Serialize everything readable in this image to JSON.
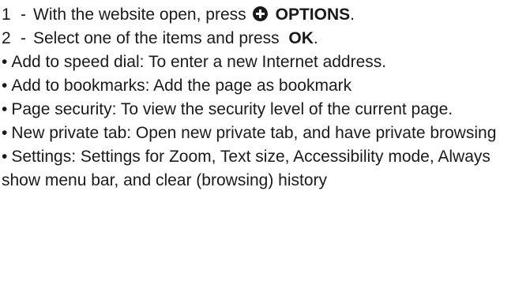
{
  "steps": [
    {
      "number": "1",
      "dash": "-",
      "text_before": "With the website open, press",
      "icon": "plus-circle-icon",
      "key_label": "OPTIONS",
      "text_after": "."
    },
    {
      "number": "2",
      "dash": "-",
      "text_before": "Select one of the items and press",
      "key_label": "OK",
      "text_after": "."
    }
  ],
  "bullet_char": "•",
  "items": [
    "Add to speed dial: To enter a new Internet address.",
    "Add to bookmarks: Add the page as bookmark",
    "Page security: To view the security level of the current page.",
    "New private tab: Open new private tab, and have private browsing",
    "Settings: Settings for Zoom, Text size, Accessibility mode, Always show menu bar, and clear (browsing) history"
  ]
}
